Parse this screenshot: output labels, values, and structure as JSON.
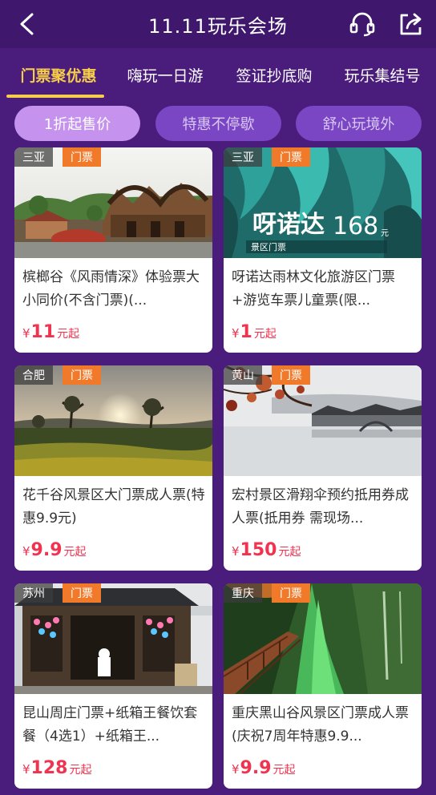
{
  "header": {
    "title": "11.11玩乐会场"
  },
  "tabs": [
    {
      "label": "门票聚优惠",
      "active": true
    },
    {
      "label": "嗨玩一日游",
      "active": false
    },
    {
      "label": "签证抄底购",
      "active": false
    },
    {
      "label": "玩乐集结号",
      "active": false
    }
  ],
  "filters": [
    {
      "label": "1折起售价",
      "active": true
    },
    {
      "label": "特惠不停歇",
      "active": false
    },
    {
      "label": "舒心玩境外",
      "active": false
    }
  ],
  "cards": [
    {
      "city": "三亚",
      "type": "门票",
      "name": "槟榔谷《风雨情深》体验票大小同价(不含门票)(...",
      "currency": "¥",
      "price": "11",
      "suffix": "元起"
    },
    {
      "city": "三亚",
      "type": "门票",
      "name": "呀诺达雨林文化旅游区门票+游览车票儿童票(限...",
      "currency": "¥",
      "price": "1",
      "suffix": "元起",
      "image_text": {
        "brand": "呀诺达",
        "number": "168",
        "unit": "元",
        "label": "景区门票"
      }
    },
    {
      "city": "合肥",
      "type": "门票",
      "name": "花千谷风景区大门票成人票(特惠9.9元)",
      "currency": "¥",
      "price": "9.9",
      "suffix": "元起"
    },
    {
      "city": "黄山",
      "type": "门票",
      "name": "宏村景区滑翔伞预约抵用券成人票(抵用券 需现场...",
      "currency": "¥",
      "price": "150",
      "suffix": "元起"
    },
    {
      "city": "苏州",
      "type": "门票",
      "name": "昆山周庄门票+纸箱王餐饮套餐（4选1）+纸箱王...",
      "currency": "¥",
      "price": "128",
      "suffix": "元起"
    },
    {
      "city": "重庆",
      "type": "门票",
      "name": "重庆黑山谷风景区门票成人票(庆祝7周年特惠9.9...",
      "currency": "¥",
      "price": "9.9",
      "suffix": "元起"
    }
  ],
  "colors": {
    "background": "#4a1d7c",
    "active_tab": "#f6cd4a",
    "price": "#f2334f",
    "type_tag": "#f07a2a"
  }
}
